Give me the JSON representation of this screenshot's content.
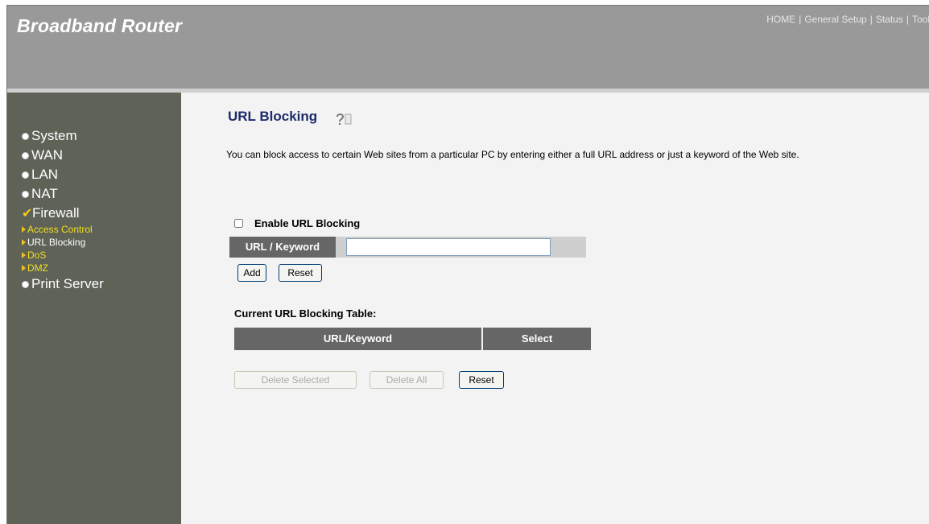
{
  "header": {
    "brand": "Broadband Router",
    "nav": [
      "HOME",
      "General Setup",
      "Status",
      "Tool"
    ]
  },
  "sidebar": {
    "items": [
      {
        "label": "System"
      },
      {
        "label": "WAN"
      },
      {
        "label": "LAN"
      },
      {
        "label": "NAT"
      },
      {
        "label": "Firewall"
      }
    ],
    "subitems": [
      {
        "label": "Access Control"
      },
      {
        "label": "URL Blocking"
      },
      {
        "label": "DoS"
      },
      {
        "label": "DMZ"
      }
    ],
    "last_item": "Print Server"
  },
  "main": {
    "title": "URL Blocking",
    "description": "You can block access to certain Web sites from a particular PC by entering either a full URL address or just a keyword of the Web site.",
    "enable_label": "Enable URL Blocking",
    "url_label": "URL / Keyword",
    "url_value": "",
    "add_button": "Add",
    "reset_button": "Reset",
    "table_title": "Current URL Blocking Table:",
    "table_columns": [
      "URL/Keyword",
      "Select"
    ],
    "delete_selected_button": "Delete Selected",
    "delete_all_button": "Delete All",
    "reset_table_button": "Reset"
  },
  "colors": {
    "header_bg": "#999999",
    "sidebar_bg": "#5e6257",
    "title": "#1e2b6b",
    "submenu": "#f0e020"
  }
}
